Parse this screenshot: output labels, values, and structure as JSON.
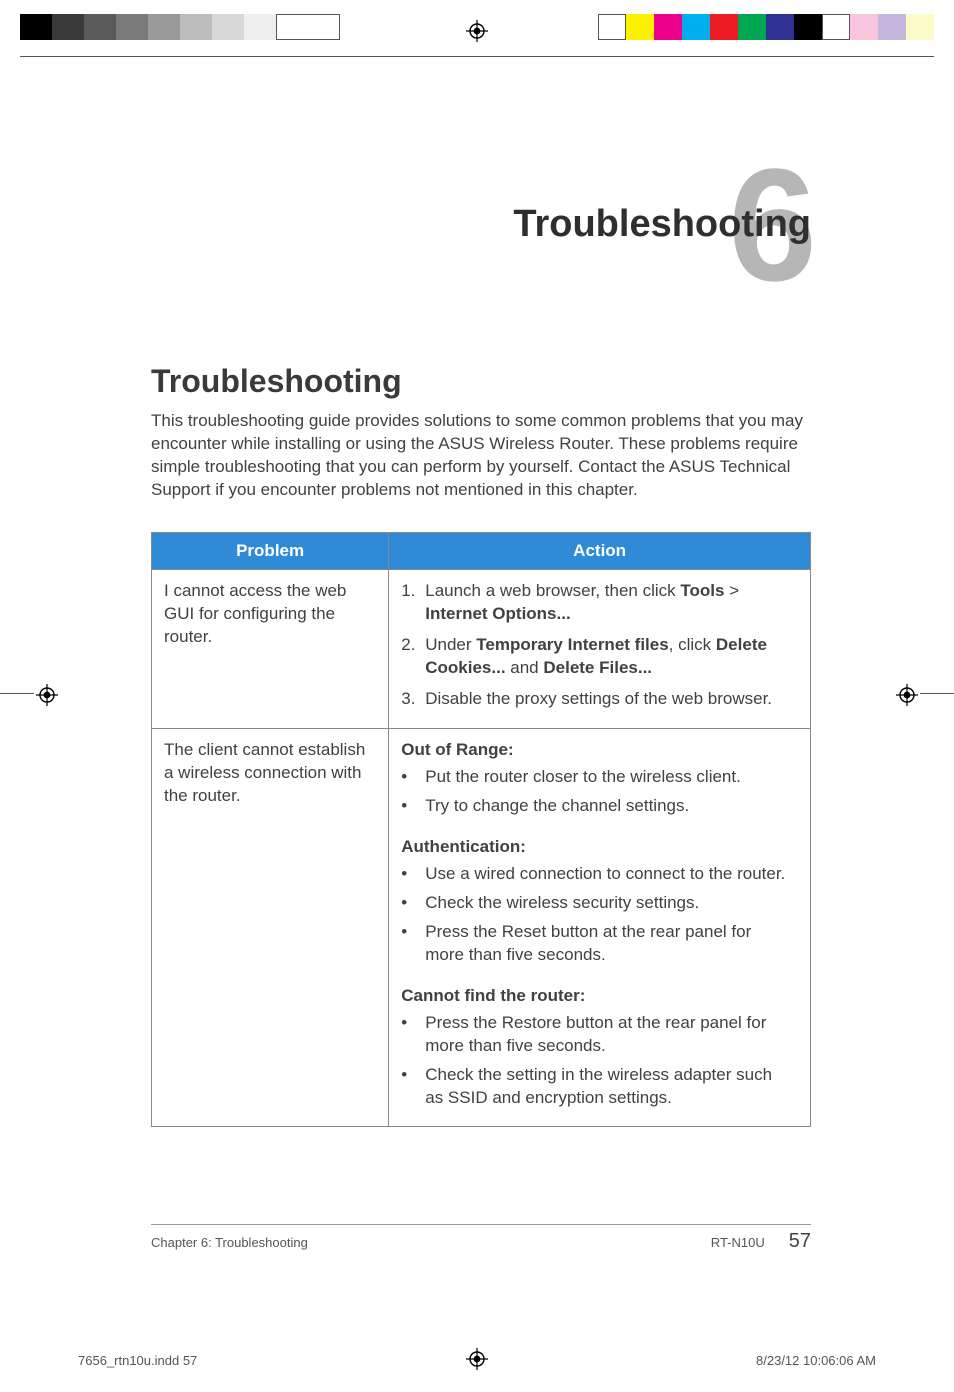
{
  "chapter_number": "6",
  "chapter_title": "Troubleshooting",
  "section_heading": "Troubleshooting",
  "intro": "This troubleshooting guide provides solutions to some common problems that you may encounter while installing or using the ASUS Wireless Router. These problems require simple troubleshooting that you can perform by yourself. Contact the ASUS Technical Support if you encounter problems not mentioned in this chapter.",
  "table": {
    "headers": {
      "problem": "Problem",
      "action": "Action"
    },
    "rows": [
      {
        "problem": "I cannot access the web GUI for configuring the router.",
        "ol": [
          {
            "n": "1.",
            "pre": "Launch a web browser, then click ",
            "b1": "Tools",
            "mid": " > ",
            "b2": "Internet Options..."
          },
          {
            "n": "2.",
            "pre": "Under ",
            "b1": "Temporary Internet files",
            "mid": ", click ",
            "b2": "Delete Cookies...",
            "mid2": " and ",
            "b3": "Delete Files..."
          },
          {
            "n": "3.",
            "pre": "Disable the proxy settings of the web browser."
          }
        ]
      },
      {
        "problem": "The client cannot establish a wireless connection with the router.",
        "groups": [
          {
            "head": "Out of Range:",
            "items": [
              "Put the router closer to the wireless client.",
              "Try to change the channel settings."
            ]
          },
          {
            "head": "Authentication:",
            "items": [
              "Use a wired connection to connect to the router.",
              "Check the wireless security settings.",
              "Press the Reset button at the rear panel for more than five seconds."
            ]
          },
          {
            "head": "Cannot find the router:",
            "items": [
              "Press the Restore button at the rear panel for more than five seconds.",
              "Check the setting in the wireless adapter such as SSID and encryption settings."
            ]
          }
        ]
      }
    ]
  },
  "footer": {
    "left": "Chapter 6: Troubleshooting",
    "model": "RT-N10U",
    "page": "57"
  },
  "imposition": {
    "left": "7656_rtn10u.indd   57",
    "right": "8/23/12   10:06:06 AM"
  },
  "colors": {
    "left_bars": [
      "#000000",
      "#3a3a3a",
      "#5a5a5a",
      "#7a7a7a",
      "#9a9a9a",
      "#bcbcbc",
      "#d8d8d8",
      "#eeeeee",
      "#ffffff",
      "#ffffff"
    ],
    "right_bars": [
      "#ffffff",
      "#fff200",
      "#ec008c",
      "#00a2ff",
      "#ec1c24",
      "#00a651",
      "#2e3192",
      "#000000",
      "#ffffff",
      "#f7c6dc",
      "#c4b8e0",
      "#fdfbc8"
    ]
  }
}
